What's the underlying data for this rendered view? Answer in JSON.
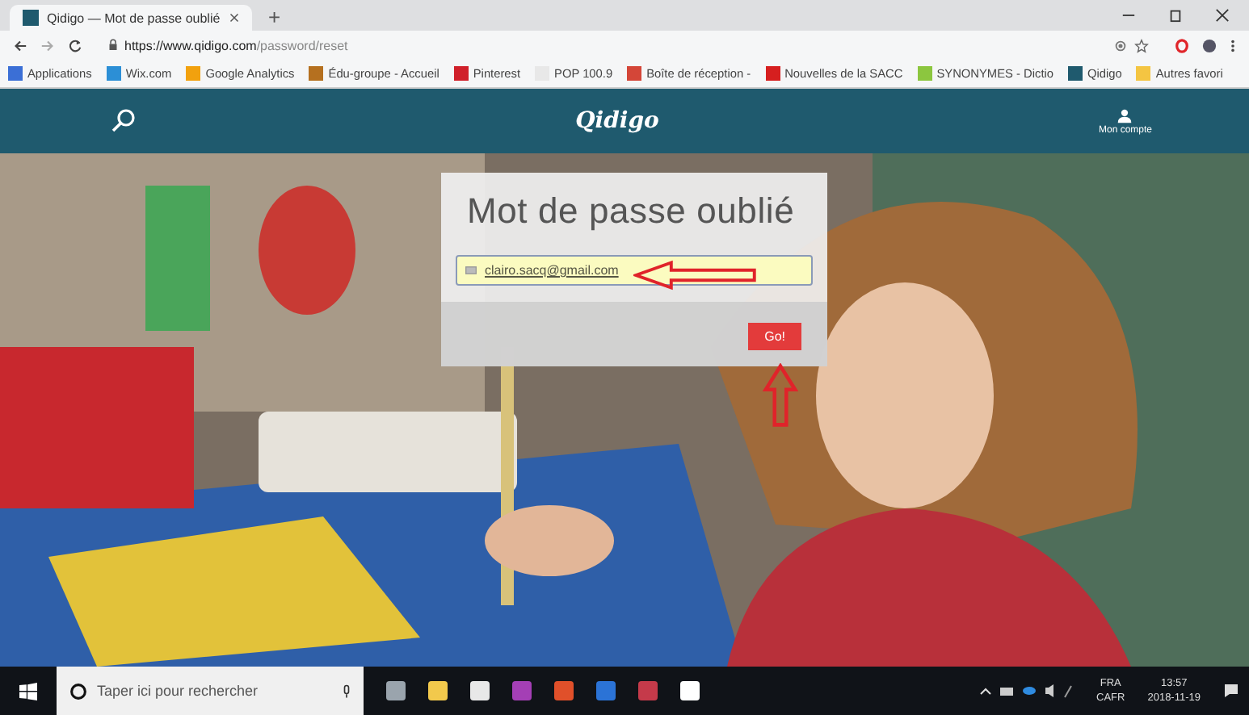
{
  "browser": {
    "tabs": [
      {
        "title": "Qidigo — Mot de passe oublié",
        "selected": true
      }
    ],
    "new_tab": "+",
    "url": {
      "domain": "https://www.qidigo.com",
      "path": "/password/reset"
    },
    "bookmarks": [
      {
        "label": "Applications",
        "color": "#3b6fd6"
      },
      {
        "label": "Wix.com",
        "color": "#2c8fd6"
      },
      {
        "label": "Google Analytics",
        "color": "#f2a10e"
      },
      {
        "label": "Édu-groupe - Accueil",
        "color": "#b5701f"
      },
      {
        "label": "Pinterest",
        "color": "#d0202a"
      },
      {
        "label": "POP 100.9",
        "color": "#e8e8e8"
      },
      {
        "label": "Boîte de réception -",
        "color": "#d44638"
      },
      {
        "label": "Nouvelles de la SACC",
        "color": "#d61f1f"
      },
      {
        "label": "SYNONYMES - Dictio",
        "color": "#8cc63f"
      },
      {
        "label": "Qidigo",
        "color": "#1f5a6e"
      },
      {
        "label": "Autres favori",
        "color": "#f4c542"
      }
    ]
  },
  "site": {
    "logo": "Qidigo",
    "account": "Mon compte"
  },
  "form": {
    "title": "Mot de passe oublié",
    "email": "clairo.sacq@gmail.com",
    "submit": "Go!"
  },
  "taskbar": {
    "search_placeholder": "Taper ici pour rechercher",
    "apps": [
      {
        "color": "#9aa4ad"
      },
      {
        "color": "#f2c94c"
      },
      {
        "color": "#e8e8e8"
      },
      {
        "color": "#a43fb5"
      },
      {
        "color": "#e0502a"
      },
      {
        "color": "#2b73d6"
      },
      {
        "color": "#c53a4a"
      },
      {
        "color": "#ffffff"
      }
    ],
    "language": "FRA",
    "layout": "CAFR",
    "time": "13:57",
    "date": "2018-11-19"
  }
}
